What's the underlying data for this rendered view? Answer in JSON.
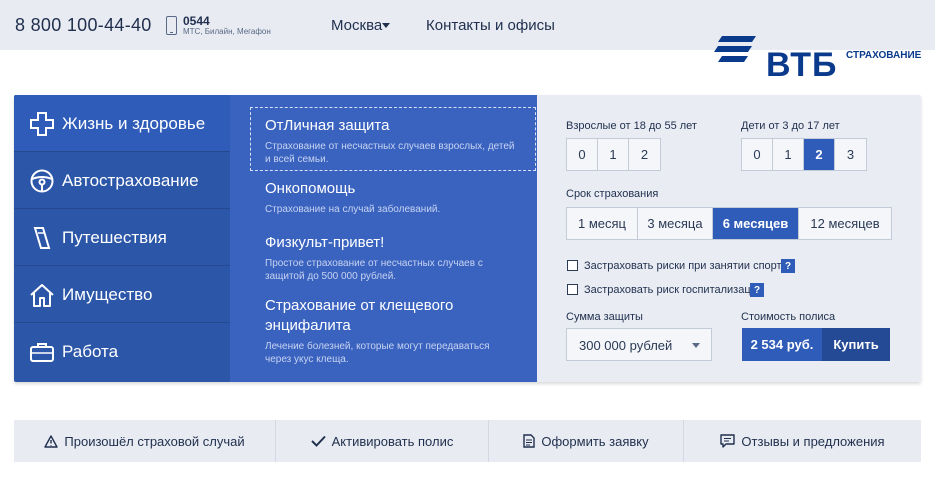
{
  "header": {
    "phone": "8 800 100-44-40",
    "mobile_number": "0544",
    "mobile_operators": "МТС, Билайн, Мегафон",
    "city": "Москва",
    "contacts": "Контакты и офисы"
  },
  "logo": {
    "text": "ВТБ",
    "subtitle": "СТРАХОВАНИЕ",
    "brand_color": "#0a3a8c"
  },
  "categories": [
    {
      "label": "Жизнь и здоровье",
      "icon": "plus-icon"
    },
    {
      "label": "Автострахование",
      "icon": "steering-wheel-icon"
    },
    {
      "label": "Путешествия",
      "icon": "ticket-icon"
    },
    {
      "label": "Имущество",
      "icon": "house-icon"
    },
    {
      "label": "Работа",
      "icon": "briefcase-icon"
    }
  ],
  "products": [
    {
      "title": "ОтЛичная защита",
      "desc": "Страхование от несчастных случаев взрослых, детей и всей семьи."
    },
    {
      "title": "Онкопомощь",
      "desc": "Страхование на случай заболеваний."
    },
    {
      "title": "Физкульт-привет!",
      "desc": "Простое страхование от несчастных случаев с защитой до 500 000 рублей."
    },
    {
      "title": "Страхование от клещевого энцифалита",
      "desc": "Лечение болезней, которые могут передаваться через укус клеща."
    }
  ],
  "calculator": {
    "adults_label": "Взрослые от 18 до 55 лет",
    "adults_options": [
      "0",
      "1",
      "2"
    ],
    "children_label": "Дети от 3 до 17 лет",
    "children_options": [
      "0",
      "1",
      "2",
      "3"
    ],
    "children_selected": "2",
    "term_label": "Срок страхования",
    "term_options": [
      "1 месяц",
      "3 месяца",
      "6 месяцев",
      "12 месяцев"
    ],
    "term_selected": "6 месяцев",
    "sport_checkbox": "Застраховать риски при занятии спортом",
    "hospital_checkbox": "Застраховать риск госпитализации",
    "help_mark": "?",
    "sum_label": "Сумма защиты",
    "sum_value": "300 000 рублей",
    "cost_label": "Стоимость полиса",
    "cost_value": "2 534 руб.",
    "buy_label": "Купить"
  },
  "bottom_bar": [
    {
      "label": "Произошёл страховой случай",
      "icon": "warning-icon"
    },
    {
      "label": "Активировать полис",
      "icon": "checkmark-icon"
    },
    {
      "label": "Оформить заявку",
      "icon": "document-icon"
    },
    {
      "label": "Отзывы и предложения",
      "icon": "chat-icon"
    }
  ],
  "colors": {
    "primary": "#2f5cb8",
    "category_bg": "#2c56a8",
    "product_bg": "#3a63c0",
    "calc_bg": "#e9ecf3"
  }
}
